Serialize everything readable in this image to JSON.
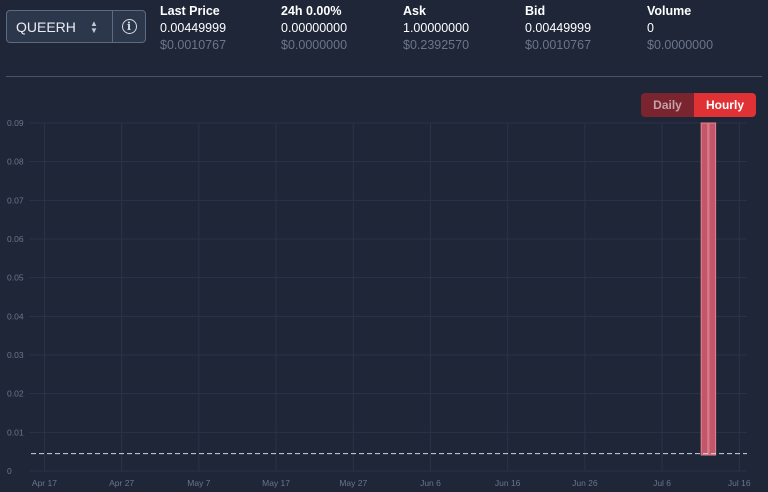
{
  "pair_selector": {
    "value": "QUEERH",
    "icon": "chevron-updown-icon",
    "info_icon": "info-icon",
    "info_glyph": "i"
  },
  "stats": [
    {
      "label": "Last Price",
      "value": "0.00449999",
      "sub": "$0.0010767"
    },
    {
      "label": "24h 0.00%",
      "value": "0.00000000",
      "sub": "$0.0000000"
    },
    {
      "label": "Ask",
      "value": "1.00000000",
      "sub": "$0.2392570"
    },
    {
      "label": "Bid",
      "value": "0.00449999",
      "sub": "$0.0010767"
    },
    {
      "label": "Volume",
      "value": "0",
      "sub": "$0.0000000"
    }
  ],
  "interval_toggle": {
    "options": [
      "Daily",
      "Hourly"
    ],
    "selected": "Hourly"
  },
  "colors": {
    "background": "#1e2638",
    "accent": "#e03135",
    "bar_fill": "#c2566b",
    "grid": "#2b3447",
    "muted_text": "#6b768a"
  },
  "chart_data": {
    "type": "bar",
    "x_ticks": [
      "Apr 17",
      "Apr 27",
      "May 7",
      "May 17",
      "May 27",
      "Jun 6",
      "Jun 16",
      "Jun 26",
      "Jul 6",
      "Jul 16"
    ],
    "y_ticks": [
      "0",
      "0.01",
      "0.02",
      "0.03",
      "0.04",
      "0.05",
      "0.06",
      "0.07",
      "0.08",
      "0.09"
    ],
    "ylim": [
      0,
      0.09
    ],
    "xlim": [
      "2023-04-15",
      "2023-07-17"
    ],
    "reference_line": {
      "value": 0.00449999,
      "style": "dashed"
    },
    "bars": [
      {
        "date": "2023-07-11",
        "value": 0.09
      },
      {
        "date": "2023-07-12",
        "value": 0.09
      }
    ],
    "grid": true
  }
}
